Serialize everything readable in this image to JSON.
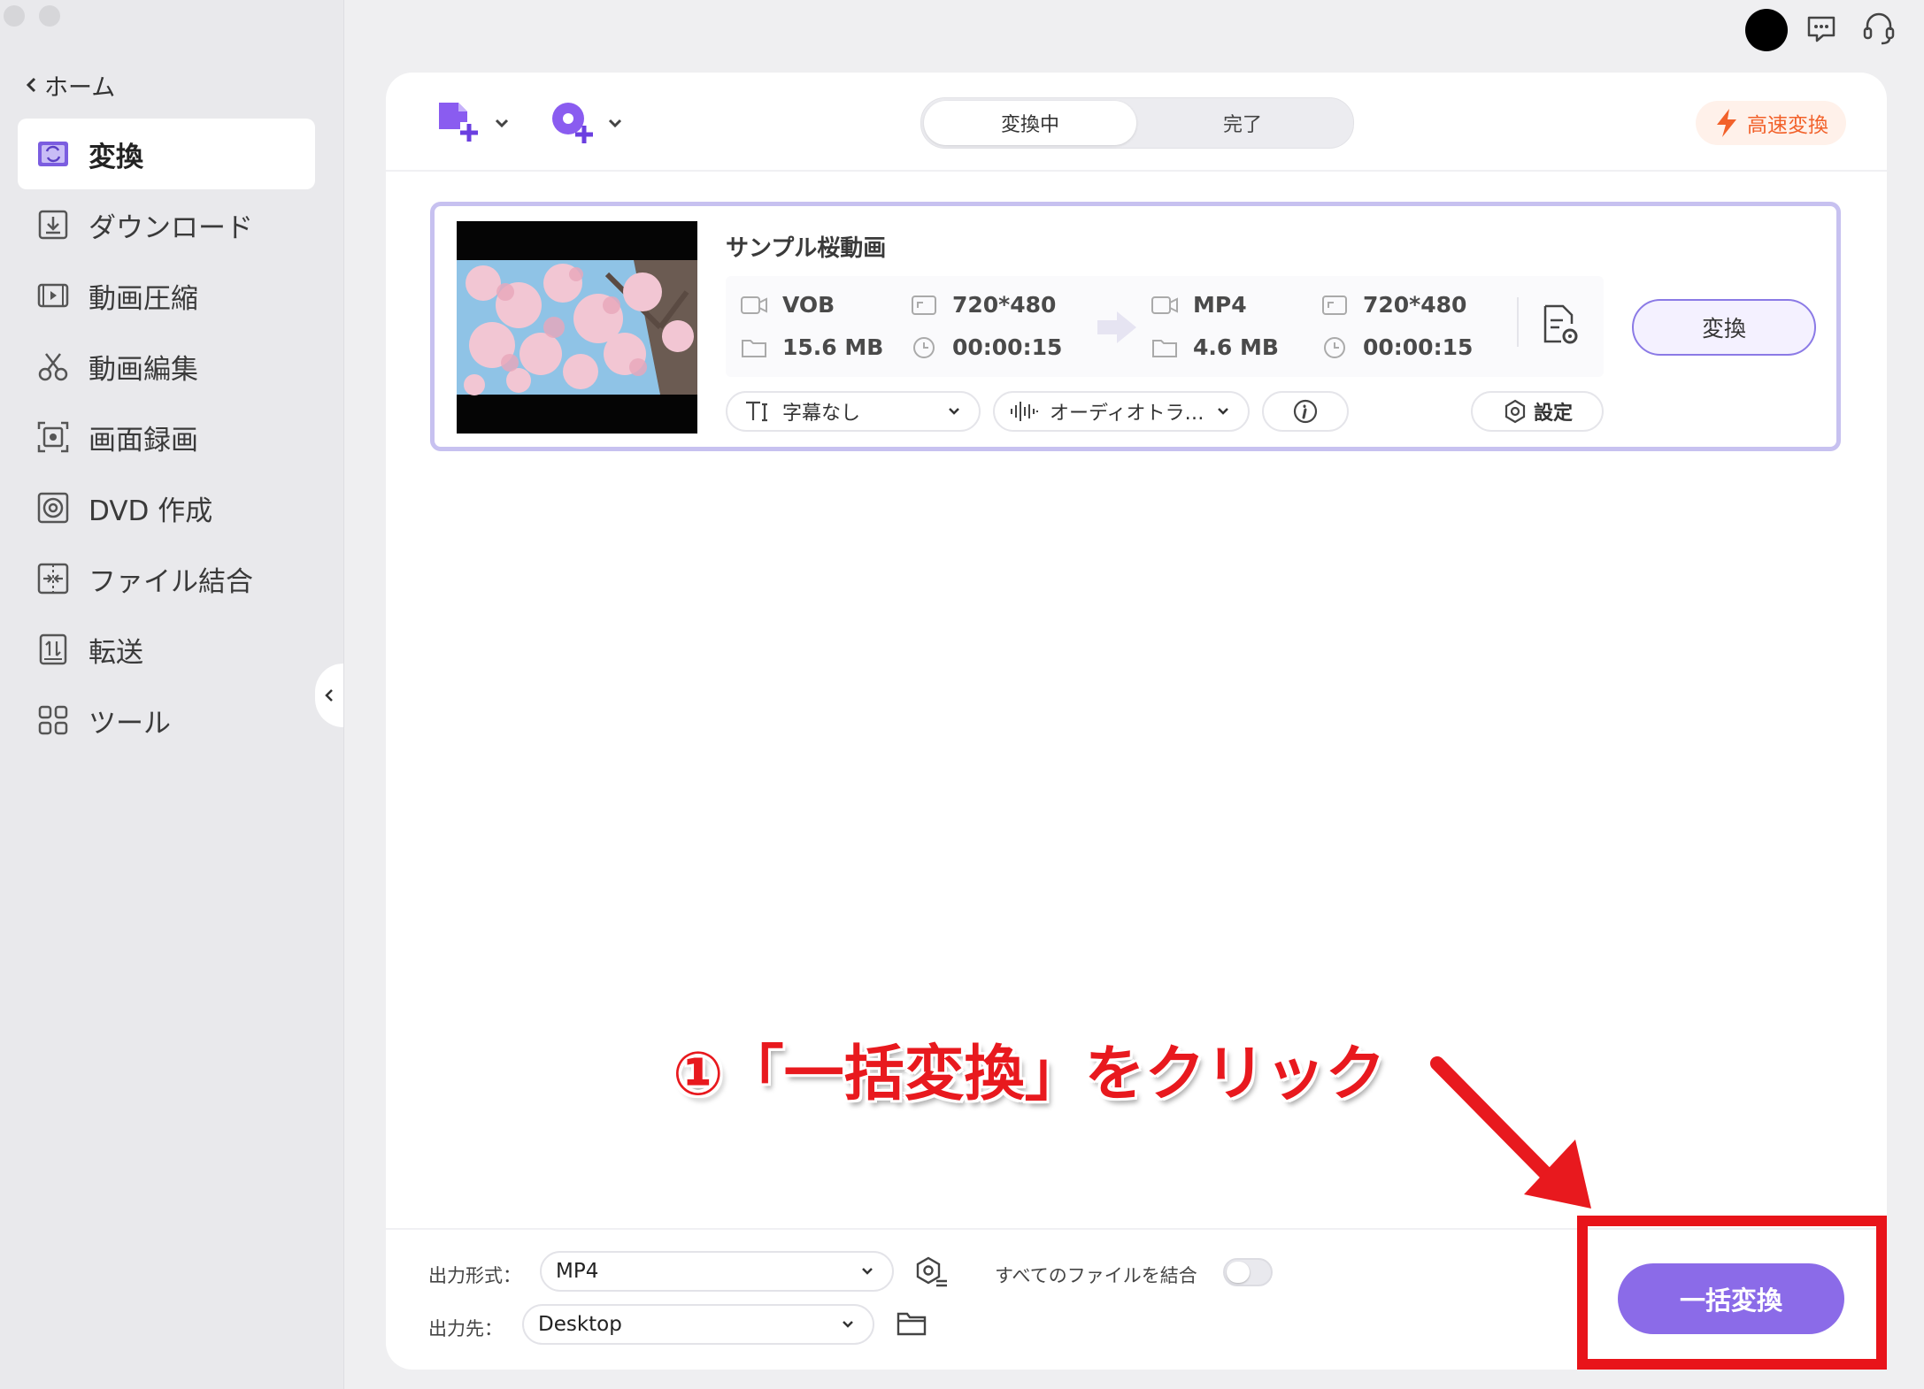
{
  "sidebar": {
    "back_label": "ホーム",
    "items": [
      {
        "label": "変換",
        "icon": "convert-icon",
        "active": true
      },
      {
        "label": "ダウンロード",
        "icon": "download-icon"
      },
      {
        "label": "動画圧縮",
        "icon": "compress-icon"
      },
      {
        "label": "動画編集",
        "icon": "scissors-icon"
      },
      {
        "label": "画面録画",
        "icon": "screen-record-icon"
      },
      {
        "label": "DVD 作成",
        "icon": "dvd-icon"
      },
      {
        "label": "ファイル結合",
        "icon": "merge-icon"
      },
      {
        "label": "転送",
        "icon": "transfer-icon"
      },
      {
        "label": "ツール",
        "icon": "tools-icon"
      }
    ]
  },
  "toolbar": {
    "tabs": {
      "converting": "変換中",
      "done": "完了"
    },
    "fast_convert": "高速変換"
  },
  "file": {
    "title": "サンプル桜動画",
    "source": {
      "format": "VOB",
      "resolution": "720*480",
      "size": "15.6 MB",
      "duration": "00:00:15"
    },
    "target": {
      "format": "MP4",
      "resolution": "720*480",
      "size": "4.6 MB",
      "duration": "00:00:15"
    },
    "convert_label": "変換",
    "subtitle_label": "字幕なし",
    "audio_label": "オーディオトラ…",
    "settings_label": "設定"
  },
  "annotation": {
    "text": "①「一括変換」をクリック",
    "color": "#e8191e"
  },
  "bottom": {
    "output_format_label": "出力形式：",
    "output_format_value": "MP4",
    "output_dest_label": "出力先：",
    "output_dest_value": "Desktop",
    "merge_label": "すべてのファイルを結合",
    "merge_enabled": false,
    "batch_convert_label": "一括変換"
  },
  "colors": {
    "accent": "#8b6be8",
    "highlight": "#e8141a",
    "fast": "#f2612a"
  }
}
